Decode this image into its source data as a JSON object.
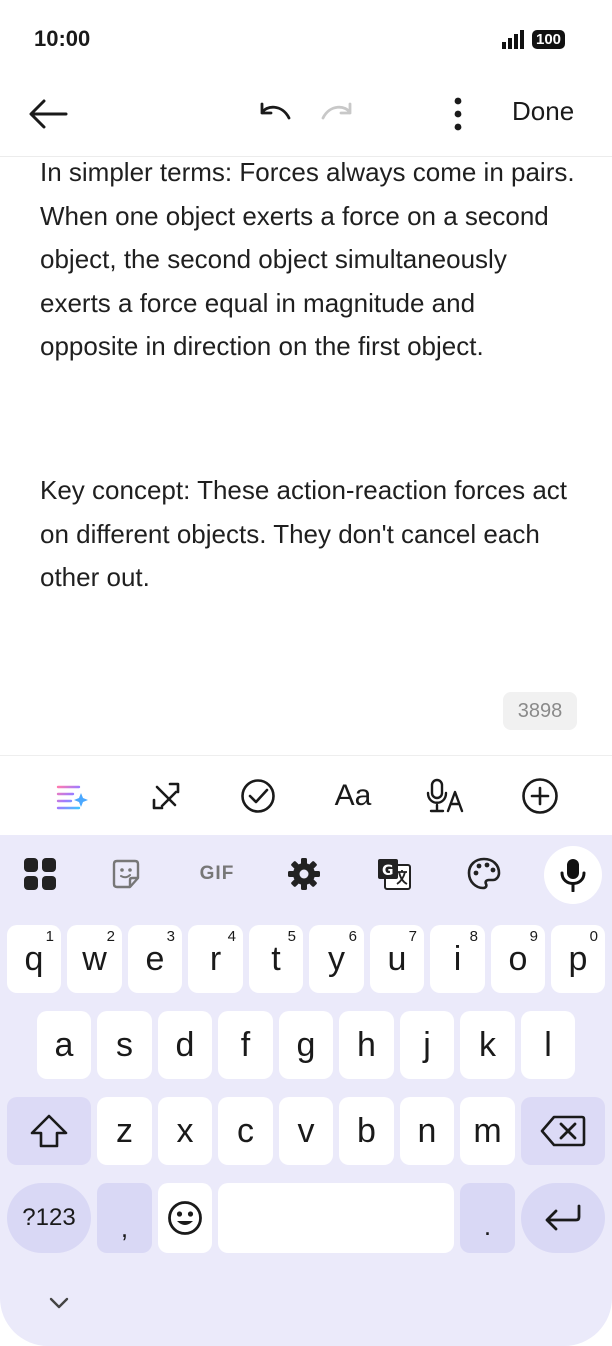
{
  "status_bar": {
    "time": "10:00",
    "battery": "100"
  },
  "toolbar": {
    "done_label": "Done"
  },
  "note": {
    "paragraphs": [
      "In simpler terms: Forces always come in pairs. When one object exerts a force on a second object, the second object simultaneously exerts a force equal in magnitude and opposite in direction on the first object.",
      "Key concept: These action-reaction forces act on different objects. They don't cancel each other out."
    ],
    "char_count": "3898"
  },
  "format_bar": {
    "text_style_label": "Aa"
  },
  "keyboard": {
    "gif_label": "GIF",
    "row1": [
      {
        "key": "q",
        "num": "1"
      },
      {
        "key": "w",
        "num": "2"
      },
      {
        "key": "e",
        "num": "3"
      },
      {
        "key": "r",
        "num": "4"
      },
      {
        "key": "t",
        "num": "5"
      },
      {
        "key": "y",
        "num": "6"
      },
      {
        "key": "u",
        "num": "7"
      },
      {
        "key": "i",
        "num": "8"
      },
      {
        "key": "o",
        "num": "9"
      },
      {
        "key": "p",
        "num": "0"
      }
    ],
    "row2": [
      "a",
      "s",
      "d",
      "f",
      "g",
      "h",
      "j",
      "k",
      "l"
    ],
    "row3": [
      "z",
      "x",
      "c",
      "v",
      "b",
      "n",
      "m"
    ],
    "symbols_label": "?123",
    "comma_label": ",",
    "period_label": "."
  },
  "colors": {
    "keyboard_bg": "#ebeafa",
    "key_bg": "#ffffff",
    "accent_key": "#dcdaf6"
  }
}
